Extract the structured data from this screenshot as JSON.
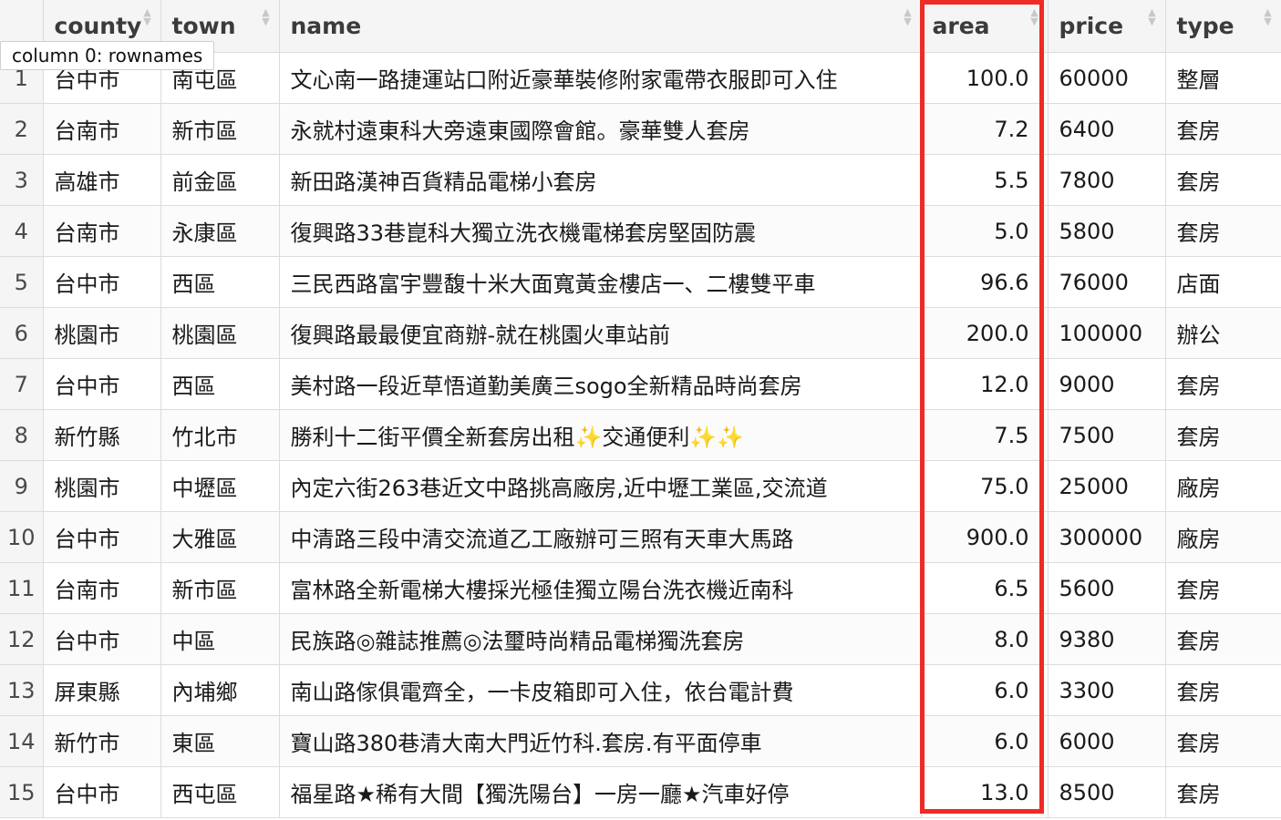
{
  "columns": [
    {
      "key": "rownames",
      "label": ""
    },
    {
      "key": "county",
      "label": "county"
    },
    {
      "key": "town",
      "label": "town"
    },
    {
      "key": "name",
      "label": "name"
    },
    {
      "key": "area",
      "label": "area"
    },
    {
      "key": "price",
      "label": "price"
    },
    {
      "key": "type",
      "label": "type"
    }
  ],
  "tooltip": "column 0: rownames",
  "highlight": {
    "column": "area",
    "color": "#ee2b24"
  },
  "rows": [
    {
      "n": "1",
      "county": "台中市",
      "town": "南屯區",
      "name": "文心南一路捷運站口附近豪華裝修附家電帶衣服即可入住",
      "area": "100.0",
      "price": "60000",
      "type": "整層"
    },
    {
      "n": "2",
      "county": "台南市",
      "town": "新市區",
      "name": "永就村遠東科大旁遠東國際會館。豪華雙人套房",
      "area": "7.2",
      "price": "6400",
      "type": "套房"
    },
    {
      "n": "3",
      "county": "高雄市",
      "town": "前金區",
      "name": "新田路漢神百貨精品電梯小套房",
      "area": "5.5",
      "price": "7800",
      "type": "套房"
    },
    {
      "n": "4",
      "county": "台南市",
      "town": "永康區",
      "name": "復興路33巷崑科大獨立洗衣機電梯套房堅固防震",
      "area": "5.0",
      "price": "5800",
      "type": "套房"
    },
    {
      "n": "5",
      "county": "台中市",
      "town": "西區",
      "name": "三民西路富宇豐馥十米大面寬黃金樓店一、二樓雙平車",
      "area": "96.6",
      "price": "76000",
      "type": "店面"
    },
    {
      "n": "6",
      "county": "桃園市",
      "town": "桃園區",
      "name": "復興路最最便宜商辦-就在桃園火車站前",
      "area": "200.0",
      "price": "100000",
      "type": "辦公"
    },
    {
      "n": "7",
      "county": "台中市",
      "town": "西區",
      "name": "美村路一段近草悟道勤美廣三sogo全新精品時尚套房",
      "area": "12.0",
      "price": "9000",
      "type": "套房"
    },
    {
      "n": "8",
      "county": "新竹縣",
      "town": "竹北市",
      "name": "勝利十二街平價全新套房出租✨交通便利✨✨",
      "area": "7.5",
      "price": "7500",
      "type": "套房"
    },
    {
      "n": "9",
      "county": "桃園市",
      "town": "中壢區",
      "name": "內定六街263巷近文中路挑高廠房,近中壢工業區,交流道",
      "area": "75.0",
      "price": "25000",
      "type": "廠房"
    },
    {
      "n": "10",
      "county": "台中市",
      "town": "大雅區",
      "name": "中清路三段中清交流道乙工廠辦可三照有天車大馬路",
      "area": "900.0",
      "price": "300000",
      "type": "廠房"
    },
    {
      "n": "11",
      "county": "台南市",
      "town": "新市區",
      "name": "富林路全新電梯大樓採光極佳獨立陽台洗衣機近南科",
      "area": "6.5",
      "price": "5600",
      "type": "套房"
    },
    {
      "n": "12",
      "county": "台中市",
      "town": "中區",
      "name": "民族路◎雜誌推薦◎法璽時尚精品電梯獨洗套房",
      "area": "8.0",
      "price": "9380",
      "type": "套房"
    },
    {
      "n": "13",
      "county": "屏東縣",
      "town": "內埔鄉",
      "name": "南山路傢俱電齊全，一卡皮箱即可入住，依台電計費",
      "area": "6.0",
      "price": "3300",
      "type": "套房"
    },
    {
      "n": "14",
      "county": "新竹市",
      "town": "東區",
      "name": "寶山路380巷清大南大門近竹科.套房.有平面停車",
      "area": "6.0",
      "price": "6000",
      "type": "套房"
    },
    {
      "n": "15",
      "county": "台中市",
      "town": "西屯區",
      "name": "福星路★稀有大間【獨洗陽台】一房一廳★汽車好停",
      "area": "13.0",
      "price": "8500",
      "type": "套房"
    }
  ]
}
